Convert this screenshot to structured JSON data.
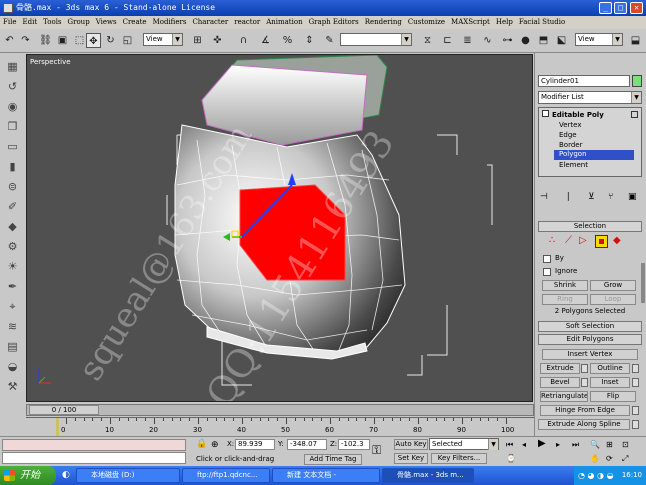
{
  "window": {
    "title": "骨骼.max - 3ds max 6 - Stand-alone License",
    "minimize": "_",
    "maximize": "□",
    "close": "✕"
  },
  "menu": [
    "File",
    "Edit",
    "Tools",
    "Group",
    "Views",
    "Create",
    "Modifiers",
    "Character",
    "reactor",
    "Animation",
    "Graph Editors",
    "Rendering",
    "Customize",
    "MAXScript",
    "Help",
    "Facial Studio"
  ],
  "toolbar": {
    "refcoord": "View",
    "refcoord2": "View"
  },
  "viewport": {
    "label": "Perspective"
  },
  "panel": {
    "object_name": "Cylinder01",
    "object_color": "#7ae07a",
    "modifier_list": "Modifier List",
    "stack": {
      "title": "Editable Poly",
      "items": [
        "Vertex",
        "Edge",
        "Border",
        "Polygon",
        "Element"
      ],
      "selected": "Polygon"
    },
    "selection": {
      "title": "Selection",
      "by_label": "By",
      "ignore_label": "Ignore",
      "shrink": "Shrink",
      "grow": "Grow",
      "ring": "Ring",
      "loop": "Loop",
      "status": "2 Polygons Selected"
    },
    "soft_selection": "Soft Selection",
    "edit_polygons": {
      "title": "Edit Polygons",
      "insert_vertex": "Insert Vertex",
      "extrude": "Extrude",
      "outline": "Outline",
      "bevel": "Bevel",
      "inset": "Inset",
      "retriangulate": "Retriangulate",
      "flip": "Flip",
      "hinge": "Hinge From Edge",
      "extrude_spline": "Extrude Along Spline"
    }
  },
  "timeline": {
    "frame": "0 / 100",
    "ticks": [
      "0",
      "10",
      "20",
      "30",
      "40",
      "50",
      "60",
      "70",
      "80",
      "90",
      "100"
    ]
  },
  "status": {
    "x_label": "X:",
    "x_value": "89.939",
    "y_label": "Y:",
    "y_value": "-348.07",
    "z_label": "Z:",
    "z_value": "-102.3",
    "prompt": "Click or click-and-drag",
    "add_time_tag": "Add Time Tag",
    "auto_key": "Auto Key",
    "set_key": "Set Key",
    "selected": "Selected",
    "key_filters": "Key Filters..."
  },
  "taskbar": {
    "start": "开始",
    "tasks": [
      "本地磁盘 (D:)",
      "ftp://ftp1.qdcnc...",
      "新建 文本文档 -",
      "骨骼.max - 3ds m..."
    ],
    "active_index": 3,
    "clock": "16:10"
  },
  "watermark": {
    "line1": "squeal@163.com",
    "line2": "QQ:1154116493"
  },
  "colors": {
    "selection_red": "#ff0000",
    "titlebar": "#0a3fb0",
    "viewport_bg": "#505050"
  }
}
